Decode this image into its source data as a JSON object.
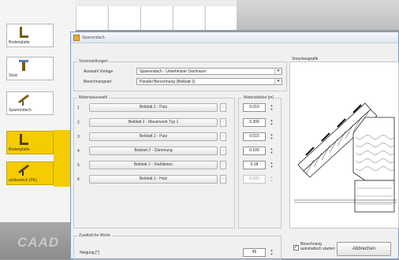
{
  "background": {
    "logo_text": "CAAD",
    "tools": [
      {
        "label": "Bodenplatte",
        "icon": "floor-slab-icon"
      },
      {
        "label": "Stutz",
        "icon": "column-icon"
      },
      {
        "label": "Sparrendach",
        "icon": "rafter-roof-icon"
      },
      {
        "label": "Bodenplatte",
        "icon": "floor-slab-icon"
      },
      {
        "label": "achbereich (PE)",
        "icon": "roof-area-icon"
      }
    ]
  },
  "dialog": {
    "title": "Sparrendach",
    "settings": {
      "group_title": "Voreinstellungen",
      "template_label": "Auswahl Vorlage",
      "template_value": "Sparrendach - Unbeheizter Dachraum",
      "calc_label": "Berechnungsart",
      "calc_value": "Parallel Berechnung (Beiblatt 2)"
    },
    "materials": {
      "group_title": "Materialauswahl",
      "thickness_title": "Materialdicke [m]",
      "rows": [
        {
          "num": "1",
          "name": "Beiblatt 2 - Putz",
          "thickness": "0.010",
          "disabled": false
        },
        {
          "num": "2",
          "name": "Beiblatt 2 - Mauerwerk Typ 1",
          "thickness": "0.300",
          "disabled": false
        },
        {
          "num": "3",
          "name": "Beiblatt 2 - Putz",
          "thickness": "0.015",
          "disabled": false
        },
        {
          "num": "4",
          "name": "Beiblatt 2 - Dämmung",
          "thickness": "0.100",
          "disabled": false
        },
        {
          "num": "5",
          "name": "Beiblatt 2 - Stahlbeton",
          "thickness": "0.18",
          "disabled": false
        },
        {
          "num": "6",
          "name": "Beiblatt 2 - Holz",
          "thickness": "0.000",
          "disabled": true
        }
      ],
      "row_button": "·"
    },
    "preview": {
      "group_title": "Vorschaugrafik"
    },
    "extra": {
      "group_title": "Zusätzliche Werte",
      "incline_label": "Neigung [°]",
      "incline_value": "45"
    },
    "auto_calc": {
      "label": "Berechnung automatisch starten",
      "checked": "✓"
    },
    "cancel_label": "Abbrechen"
  }
}
